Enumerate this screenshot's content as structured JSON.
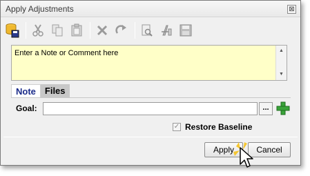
{
  "window": {
    "title": "Apply Adjustments",
    "close_glyph": "⊠"
  },
  "toolbar": {
    "icons": [
      "database-save-icon",
      "cut-icon",
      "copy-icon",
      "paste-icon",
      "delete-icon",
      "redo-icon",
      "search-document-icon",
      "rename-icon",
      "save-disk-icon"
    ]
  },
  "note": {
    "text": "Enter a Note or Comment here",
    "scroll_up": "▲",
    "scroll_down": "▼"
  },
  "tabs": [
    {
      "label": "Note",
      "active": true
    },
    {
      "label": "Files",
      "active": false
    }
  ],
  "goal": {
    "label": "Goal:",
    "value": "",
    "browse_label": "..."
  },
  "restore": {
    "label": "Restore Baseline",
    "checked": true,
    "check_glyph": "✓"
  },
  "buttons": {
    "apply": "Apply",
    "cancel": "Cancel"
  },
  "colors": {
    "note_bg": "#ffffc8",
    "active_tab_text": "#1a2b8a",
    "add_green": "#3aa33a"
  }
}
